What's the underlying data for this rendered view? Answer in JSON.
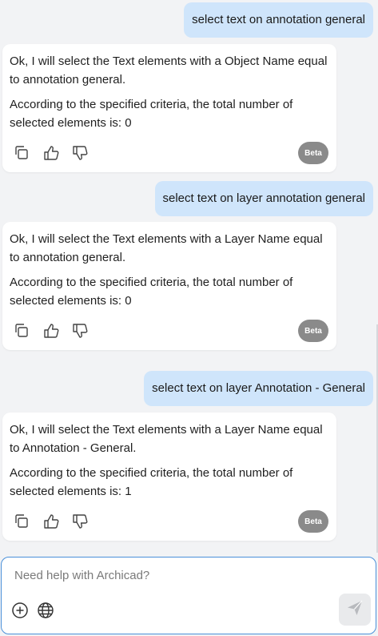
{
  "messages": [
    {
      "role": "user",
      "text": "select text on annotation general"
    },
    {
      "role": "assistant",
      "line1": "Ok, I will select the Text elements with a Object Name equal to annotation general.",
      "line2": "According to the specified criteria, the total number of selected elements is: 0",
      "badge": "Beta"
    },
    {
      "role": "user",
      "text": "select text on layer annotation general"
    },
    {
      "role": "assistant",
      "line1": "Ok, I will select the Text elements with a Layer Name equal to annotation general.",
      "line2": "According to the specified criteria, the total number of selected elements is: 0",
      "badge": "Beta"
    },
    {
      "role": "user",
      "text": "select text on layer Annotation - General"
    },
    {
      "role": "assistant",
      "line1": "Ok, I will select the Text elements with a Layer Name equal to Annotation - General.",
      "line2": "According to the specified criteria, the total number of selected elements is: 1",
      "badge": "Beta"
    }
  ],
  "actions_icons": [
    "copy-icon",
    "thumbs-up-icon",
    "thumbs-down-icon"
  ],
  "composer": {
    "placeholder": "Need help with Archicad?",
    "left_icons": [
      "plus-circle-icon",
      "globe-icon"
    ],
    "send_icon": "send-icon"
  },
  "colors": {
    "user_bubble": "#cfe5fb",
    "card": "#ffffff",
    "background": "#f2f3f5",
    "badge": "#8a8a8a",
    "composer_border": "#4a90d9"
  }
}
